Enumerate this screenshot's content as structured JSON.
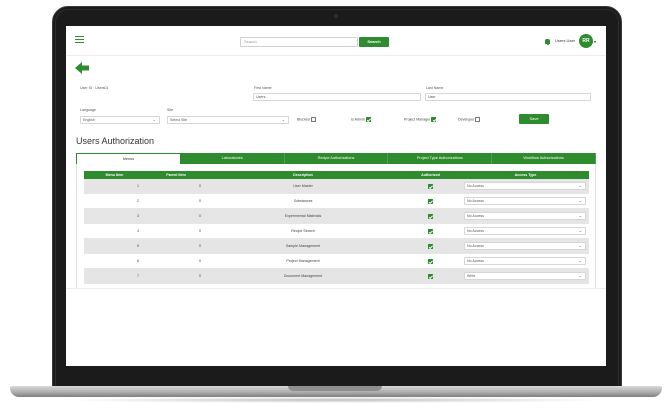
{
  "topnav": {
    "search_placeholder": "Search",
    "search_button": "Search",
    "user_name": "Users User",
    "avatar_initials": "RR",
    "caret": "▾"
  },
  "form": {
    "user_id_label": "User ID : Users01",
    "first_name_label": "First Name",
    "first_name_value": "Users",
    "last_name_label": "Last Name",
    "last_name_value": "User",
    "language_label": "Language",
    "language_value": "English",
    "site_label": "Site",
    "site_value": "Select Site",
    "blocked_label": "Blocked",
    "blocked_checked": false,
    "is_admin_label": "Is Admin",
    "is_admin_checked": true,
    "project_manager_label": "Project Manager",
    "project_manager_checked": true,
    "developer_label": "Developer",
    "developer_checked": false,
    "save_button": "Save",
    "chevron": "⌄"
  },
  "section": {
    "title": "Users Authorization"
  },
  "tabs": [
    {
      "label": "Menus",
      "active": true
    },
    {
      "label": "Laboratories",
      "active": false
    },
    {
      "label": "Recipe Authorizations",
      "active": false
    },
    {
      "label": "Project Type Authorizations",
      "active": false
    },
    {
      "label": "Workflow Authorizations",
      "active": false
    }
  ],
  "grid": {
    "headers": [
      "Menu Item",
      "Parent Item",
      "Description",
      "Authorized",
      "Access Type"
    ],
    "rows": [
      {
        "menu_item": "1",
        "parent_item": "0",
        "description": "User Master",
        "authorized": true,
        "access_type": "No Access"
      },
      {
        "menu_item": "2",
        "parent_item": "0",
        "description": "Substances",
        "authorized": true,
        "access_type": "No Access"
      },
      {
        "menu_item": "3",
        "parent_item": "0",
        "description": "Experimental Materials",
        "authorized": true,
        "access_type": "No Access"
      },
      {
        "menu_item": "4",
        "parent_item": "0",
        "description": "Recipe Search",
        "authorized": true,
        "access_type": "No Access"
      },
      {
        "menu_item": "5",
        "parent_item": "0",
        "description": "Sample Management",
        "authorized": true,
        "access_type": "No Access"
      },
      {
        "menu_item": "6",
        "parent_item": "0",
        "description": "Project Management",
        "authorized": true,
        "access_type": "No Access"
      },
      {
        "menu_item": "7",
        "parent_item": "0",
        "description": "Document Management",
        "authorized": true,
        "access_type": "Write"
      }
    ]
  },
  "colors": {
    "accent": "#2e8b2e",
    "row_alt": "#e5e5e5",
    "bezel": "#1b1b1b"
  }
}
